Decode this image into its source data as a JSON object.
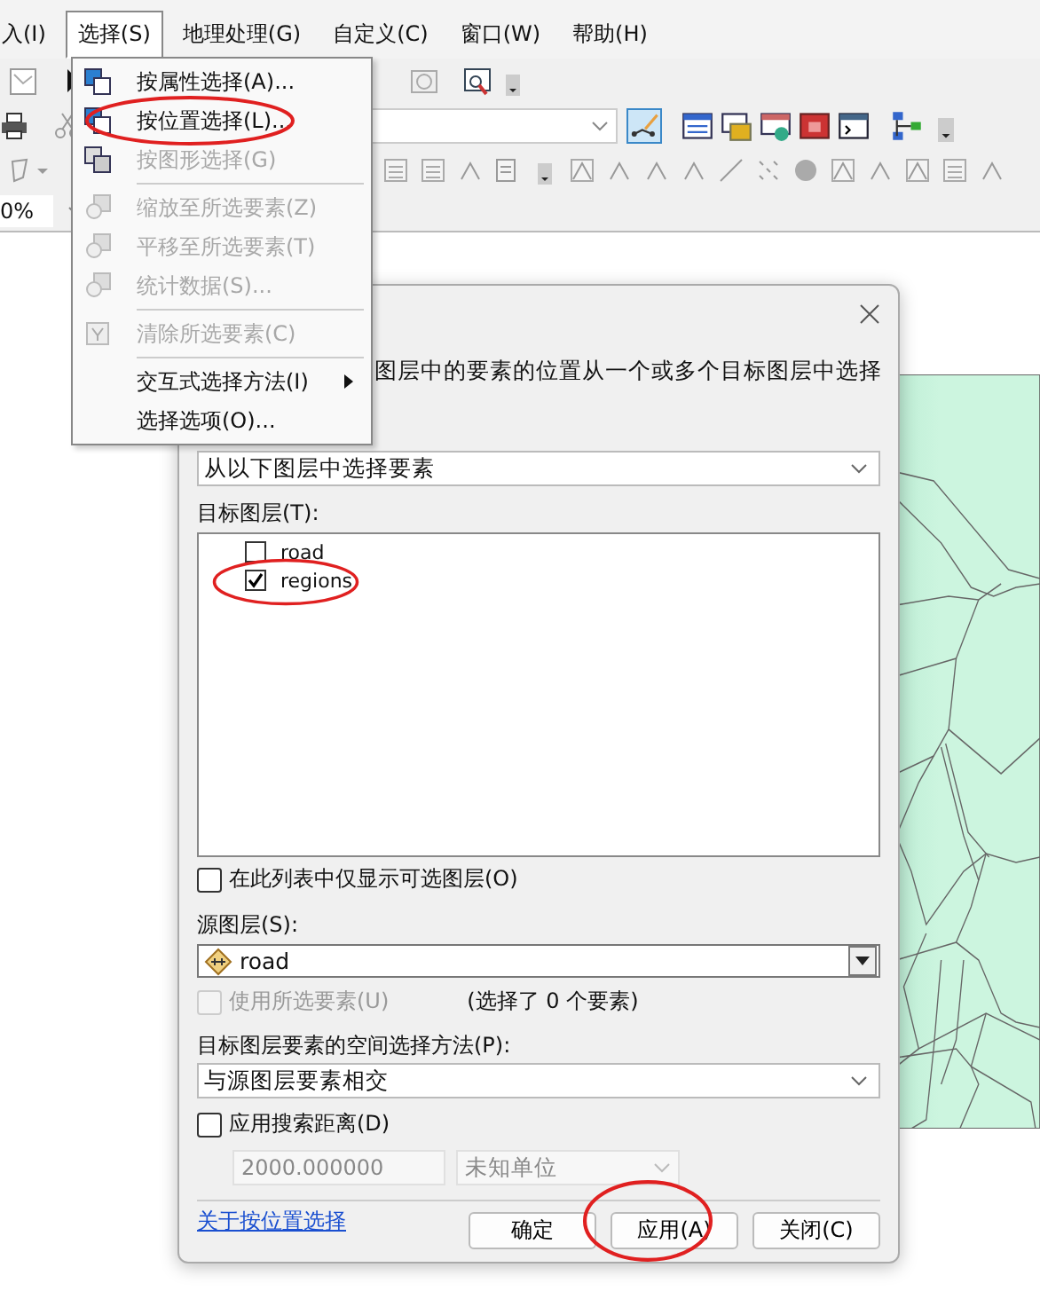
{
  "menubar": [
    {
      "label": "入(I)",
      "open": false
    },
    {
      "label": "选择(S)",
      "open": true
    },
    {
      "label": "地理处理(G)",
      "open": false
    },
    {
      "label": "自定义(C)",
      "open": false
    },
    {
      "label": "窗口(W)",
      "open": false
    },
    {
      "label": "帮助(H)",
      "open": false
    }
  ],
  "zoom_box": {
    "value": "0%"
  },
  "select_menu": {
    "items": [
      {
        "kind": "item",
        "label": "按属性选择(A)...",
        "disabled": false,
        "submenu": false
      },
      {
        "kind": "item",
        "label": "按位置选择(L)...",
        "disabled": false,
        "submenu": false
      },
      {
        "kind": "item",
        "label": "按图形选择(G)",
        "disabled": true,
        "submenu": false
      },
      {
        "kind": "separator"
      },
      {
        "kind": "item",
        "label": "缩放至所选要素(Z)",
        "disabled": true,
        "submenu": false
      },
      {
        "kind": "item",
        "label": "平移至所选要素(T)",
        "disabled": true,
        "submenu": false
      },
      {
        "kind": "item",
        "label": "统计数据(S)...",
        "disabled": true,
        "submenu": false
      },
      {
        "kind": "separator"
      },
      {
        "kind": "item",
        "label": "清除所选要素(C)",
        "disabled": true,
        "submenu": false
      },
      {
        "kind": "separator"
      },
      {
        "kind": "item",
        "label": "交互式选择方法(I)",
        "disabled": false,
        "submenu": true
      },
      {
        "kind": "item",
        "label": "选择选项(O)...",
        "disabled": false,
        "submenu": false
      }
    ]
  },
  "dialog": {
    "description": "图层中的要素的位置从一个或多个目标图层中选择",
    "method": {
      "value": "从以下图层中选择要素"
    },
    "target_label": "目标图层(T):",
    "target_layers": [
      {
        "name": "road",
        "checked": false
      },
      {
        "name": "regions",
        "checked": true
      }
    ],
    "only_selectable": {
      "label": "在此列表中仅显示可选图层(O)",
      "checked": false
    },
    "source_label": "源图层(S):",
    "source": {
      "value": "road"
    },
    "use_selected": {
      "label": "使用所选要素(U)",
      "checked": false,
      "disabled": true
    },
    "selected_count": "(选择了 0 个要素)",
    "spatial_label": "目标图层要素的空间选择方法(P):",
    "spatial": {
      "value": "与源图层要素相交"
    },
    "search_distance": {
      "label": "应用搜索距离(D)",
      "checked": false
    },
    "distance": {
      "value": "2000.000000",
      "disabled": true
    },
    "unit": {
      "value": "未知单位",
      "disabled": true
    },
    "help_link": "关于按位置选择",
    "buttons": [
      "确定",
      "应用(A)",
      "关闭(C)"
    ]
  }
}
